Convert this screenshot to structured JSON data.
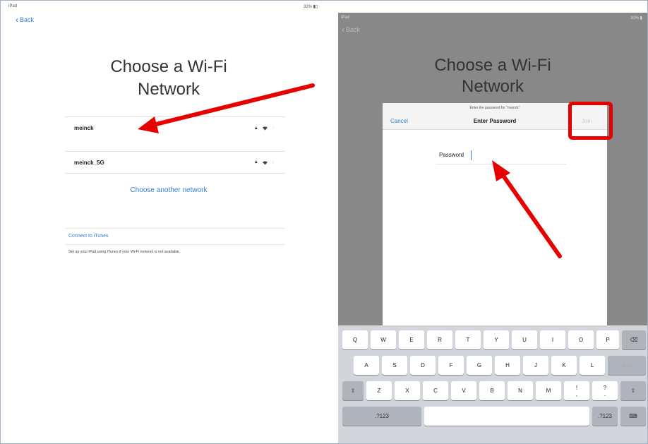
{
  "left_screen": {
    "status_device": "iPad",
    "status_battery": "32% ▮▯",
    "back_label": "Back",
    "title_line1": "Choose a Wi-Fi",
    "title_line2": "Network",
    "networks": [
      {
        "name": "meinck"
      },
      {
        "name": "meinck_5G"
      }
    ],
    "choose_another": "Choose another network",
    "itunes_link": "Connect to iTunes",
    "itunes_description": "Set up your iPad using iTunes if your Wi-Fi network is not available."
  },
  "right_screen": {
    "status_device": "iPad",
    "status_battery": "30% ▮",
    "back_label": "Back",
    "title_line1": "Choose a Wi-Fi",
    "title_line2": "Network",
    "dialog": {
      "hint": "Enter the password for \"meinck\"",
      "cancel_label": "Cancel",
      "title": "Enter Password",
      "join_label": "Join",
      "password_label": "Password",
      "password_value": ""
    },
    "keyboard": {
      "row1": [
        "Q",
        "W",
        "E",
        "R",
        "T",
        "Y",
        "U",
        "I",
        "O",
        "P"
      ],
      "row2": [
        "A",
        "S",
        "D",
        "F",
        "G",
        "H",
        "J",
        "K",
        "L"
      ],
      "row3": [
        "Z",
        "X",
        "C",
        "V",
        "B",
        "N",
        "M",
        "!",
        ","
      ],
      "row3_extra": [
        "?",
        "."
      ],
      "join_key": "Join",
      "numbers_key": ".?123",
      "backspace_symbol": "⌫",
      "shift_symbol": "⇧",
      "hide_symbol": "⌨"
    }
  },
  "colors": {
    "accent": "#2f7fd9",
    "annotation": "#e60000",
    "overlay": "#888888"
  }
}
